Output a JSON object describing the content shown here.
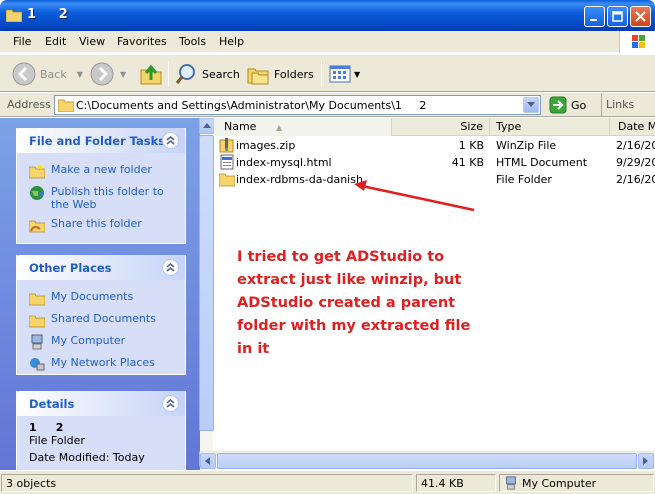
{
  "window": {
    "title": "1     2"
  },
  "menu": [
    "File",
    "Edit",
    "View",
    "Favorites",
    "Tools",
    "Help"
  ],
  "toolbar": {
    "back": "Back",
    "search": "Search",
    "folders": "Folders"
  },
  "address": {
    "label": "Address",
    "value": "C:\\Documents and Settings\\Administrator\\My Documents\\1     2",
    "go": "Go",
    "links": "Links"
  },
  "tasks": {
    "title": "File and Folder Tasks",
    "items": [
      "Make a new folder",
      "Publish this folder to the Web",
      "Share this folder"
    ]
  },
  "places": {
    "title": "Other Places",
    "items": [
      "My Documents",
      "Shared Documents",
      "My Computer",
      "My Network Places"
    ]
  },
  "details": {
    "title": "Details",
    "name": "1     2",
    "type": "File Folder",
    "modified": "Date Modified: Today"
  },
  "columns": {
    "name": "Name",
    "size": "Size",
    "type": "Type",
    "date": "Date M"
  },
  "files": [
    {
      "name": "images.zip",
      "size": "1 KB",
      "type": "WinZip File",
      "date": "2/16/20",
      "icon": "zip-icon"
    },
    {
      "name": "index-mysql.html",
      "size": "41 KB",
      "type": "HTML Document",
      "date": "9/29/20",
      "icon": "html-file-icon"
    },
    {
      "name": "index-rdbms-da-danish",
      "size": "",
      "type": "File Folder",
      "date": "2/16/20",
      "icon": "folder-icon"
    }
  ],
  "annotation": "I tried to get ADStudio to extract just like winzip, but ADStudio created a parent folder with my extracted file in it",
  "status": {
    "objects": "3 objects",
    "size": "41.4 KB",
    "location": "My Computer"
  },
  "colors": {
    "annotation": "#e02020",
    "titlebar": "#0546c2",
    "taskpane": "#6375d6"
  }
}
